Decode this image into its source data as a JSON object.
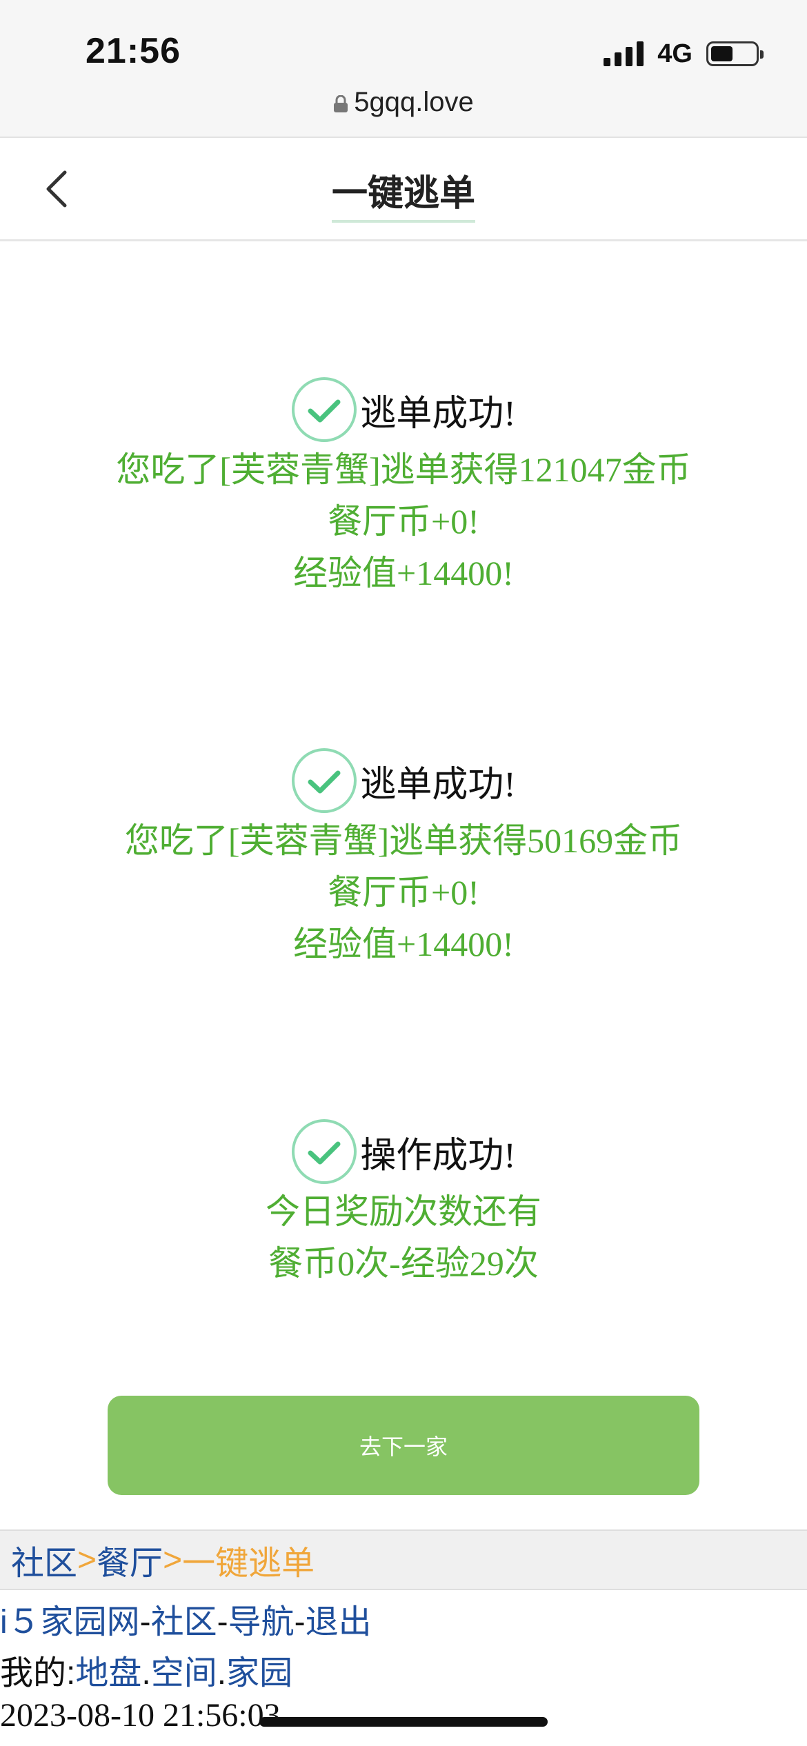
{
  "status_bar": {
    "time": "21:56",
    "network": "4G"
  },
  "browser": {
    "url": "5gqq.love"
  },
  "header": {
    "title": "一键逃单"
  },
  "results": [
    {
      "heading": "逃单成功!",
      "lines": [
        "您吃了[芙蓉青蟹]逃单获得121047金币",
        "餐厅币+0!",
        "经验值+14400!"
      ]
    },
    {
      "heading": "逃单成功!",
      "lines": [
        "您吃了[芙蓉青蟹]逃单获得50169金币",
        "餐厅币+0!",
        "经验值+14400!"
      ]
    },
    {
      "heading": "操作成功!",
      "lines": [
        "今日奖励次数还有",
        "餐币0次-经验29次"
      ]
    }
  ],
  "next_button": {
    "label": "去下一家"
  },
  "breadcrumb": {
    "items": [
      "社区",
      "餐厅",
      "一键逃单"
    ],
    "separator": ">"
  },
  "footer": {
    "site": "i５家园网",
    "dash": "-",
    "links": [
      "社区",
      "导航",
      "退出"
    ],
    "mine_label": "我的:",
    "mine_links": [
      "地盘",
      "空间",
      "家园"
    ],
    "dot": ".",
    "datetime": "2023-08-10 21:56:03"
  },
  "colors": {
    "accent_green": "#4fae33",
    "button_green": "#86c463",
    "link_blue": "#1f4f9c",
    "crumb_orange": "#f0a63a"
  }
}
